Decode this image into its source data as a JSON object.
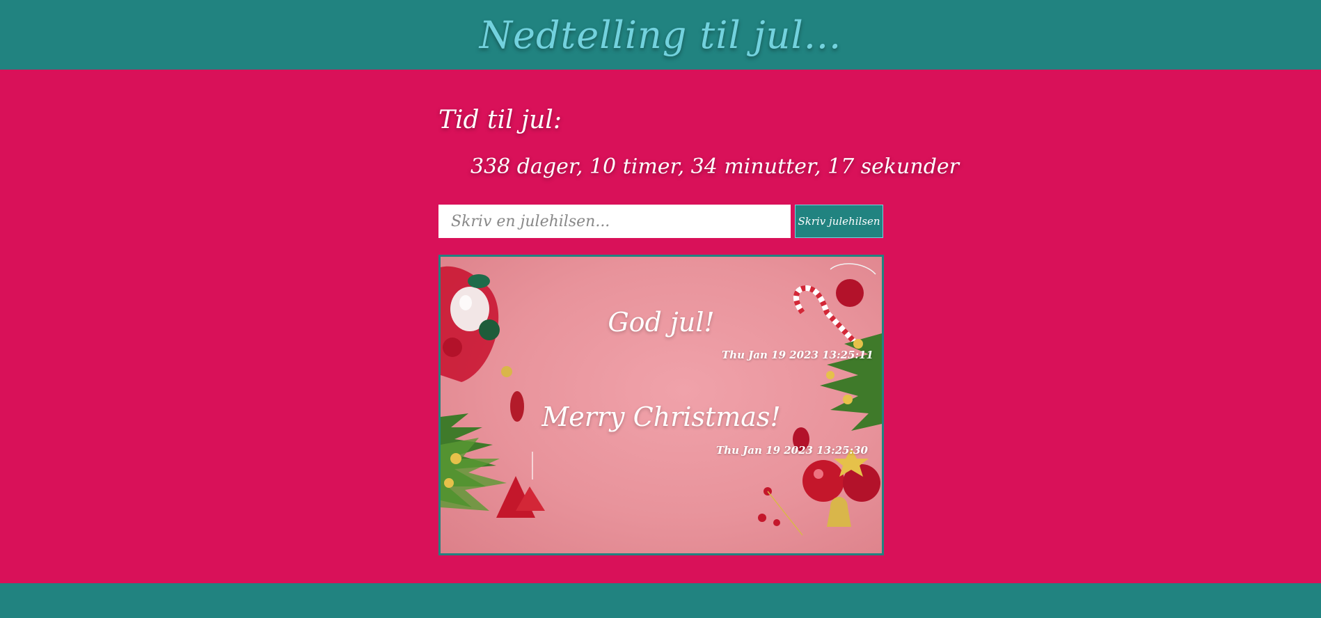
{
  "header": {
    "title": "Nedtelling til jul..."
  },
  "countdown": {
    "label": "Tid til jul:",
    "value": "338 dager, 10 timer, 34 minutter, 17 sekunder"
  },
  "form": {
    "placeholder": "Skriv en julehilsen...",
    "button_label": "Skriv julehilsen"
  },
  "greetings": [
    {
      "text": "God jul!",
      "timestamp": "Thu Jan 19 2023 13:25:11"
    },
    {
      "text": "Merry Christmas!",
      "timestamp": "Thu Jan 19 2023 13:25:30"
    }
  ],
  "colors": {
    "header_bg": "#218380",
    "page_bg": "#d91159",
    "title_color": "#73d2de",
    "card_bg": "#e8939b"
  }
}
